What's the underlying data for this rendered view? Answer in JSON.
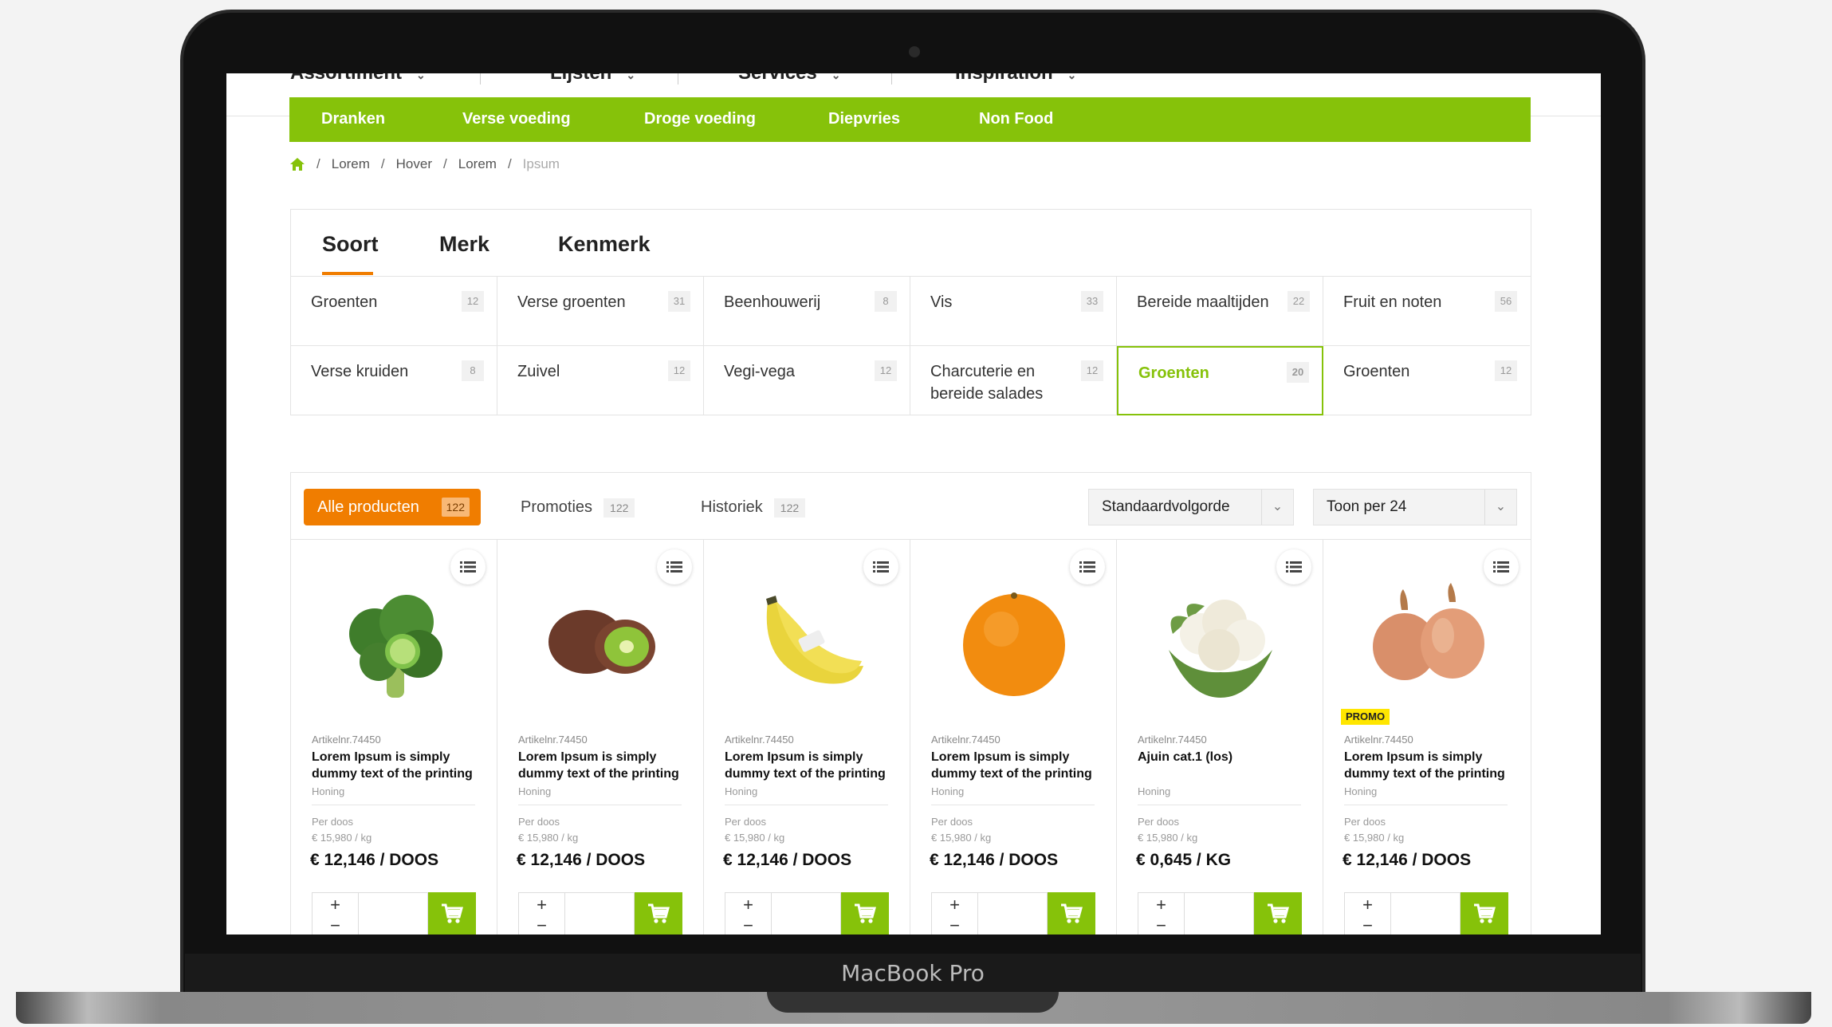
{
  "device": {
    "brand_label": "MacBook Pro"
  },
  "top_nav": [
    {
      "label": "Assortiment"
    },
    {
      "label": "Lijsten"
    },
    {
      "label": "Services"
    },
    {
      "label": "Inspiration"
    }
  ],
  "category_bar": [
    "Dranken",
    "Verse voeding",
    "Droge voeding",
    "Diepvries",
    "Non Food"
  ],
  "breadcrumb": [
    "Lorem",
    "Hover",
    "Lorem",
    "Ipsum"
  ],
  "facet": {
    "tabs": [
      "Soort",
      "Merk",
      "Kenmerk"
    ],
    "active_tab": "Soort",
    "items": [
      {
        "label": "Groenten",
        "count": "12"
      },
      {
        "label": "Verse groenten",
        "count": "31"
      },
      {
        "label": "Beenhouwerij",
        "count": "8"
      },
      {
        "label": "Vis",
        "count": "33"
      },
      {
        "label": "Bereide maaltijden",
        "count": "22"
      },
      {
        "label": "Fruit en noten",
        "count": "56"
      },
      {
        "label": "Verse kruiden",
        "count": "8"
      },
      {
        "label": "Zuivel",
        "count": "12"
      },
      {
        "label": "Vegi-vega",
        "count": "12"
      },
      {
        "label": "Charcuterie en bereide salades",
        "count": "12"
      },
      {
        "label": "Groenten",
        "count": "20",
        "active": true
      },
      {
        "label": "Groenten",
        "count": "12"
      }
    ]
  },
  "product_tabs": {
    "all": {
      "label": "Alle producten",
      "count": "122"
    },
    "promo": {
      "label": "Promoties",
      "count": "122"
    },
    "history": {
      "label": "Historiek",
      "count": "122"
    }
  },
  "sort_select": {
    "value": "Standaardvolgorde"
  },
  "per_page_select": {
    "value": "Toon per 24"
  },
  "products": [
    {
      "image": "broccoli",
      "article": "Artikelnr.74450",
      "name": "Lorem Ipsum is simply dummy text of the printing",
      "brand": "Honing",
      "per": "Per doos",
      "unit_price": "€ 15,980 / kg",
      "price": "€ 12,146 / DOOS",
      "promo": ""
    },
    {
      "image": "kiwi",
      "article": "Artikelnr.74450",
      "name": "Lorem Ipsum is simply dummy text of the printing",
      "brand": "Honing",
      "per": "Per doos",
      "unit_price": "€ 15,980 / kg",
      "price": "€ 12,146 / DOOS",
      "promo": ""
    },
    {
      "image": "banana",
      "article": "Artikelnr.74450",
      "name": "Lorem Ipsum is simply dummy text of the printing",
      "brand": "Honing",
      "per": "Per doos",
      "unit_price": "€ 15,980 / kg",
      "price": "€ 12,146 / DOOS",
      "promo": ""
    },
    {
      "image": "orange",
      "article": "Artikelnr.74450",
      "name": "Lorem Ipsum is simply dummy text of the printing",
      "brand": "Honing",
      "per": "Per doos",
      "unit_price": "€ 15,980 / kg",
      "price": "€ 12,146 / DOOS",
      "promo": ""
    },
    {
      "image": "cauliflower",
      "article": "Artikelnr.74450",
      "name": "Ajuin cat.1 (los)",
      "brand": "Honing",
      "per": "Per doos",
      "unit_price": "€ 15,980 / kg",
      "price": "€ 0,645 / KG",
      "promo": ""
    },
    {
      "image": "onion",
      "article": "Artikelnr.74450",
      "name": "Lorem Ipsum is simply dummy text of the printing",
      "brand": "Honing",
      "per": "Per doos",
      "unit_price": "€ 15,980 / kg",
      "price": "€ 12,146 / DOOS",
      "promo": "PROMO"
    }
  ],
  "qty": {
    "plus": "+",
    "minus": "−"
  },
  "colors": {
    "green": "#86c20a",
    "orange": "#f07d00",
    "promo_yellow": "#ffe600"
  },
  "icons": {
    "home": "home-icon",
    "list": "list-icon",
    "cart": "cart-icon",
    "chevron": "chevron-down-icon"
  }
}
